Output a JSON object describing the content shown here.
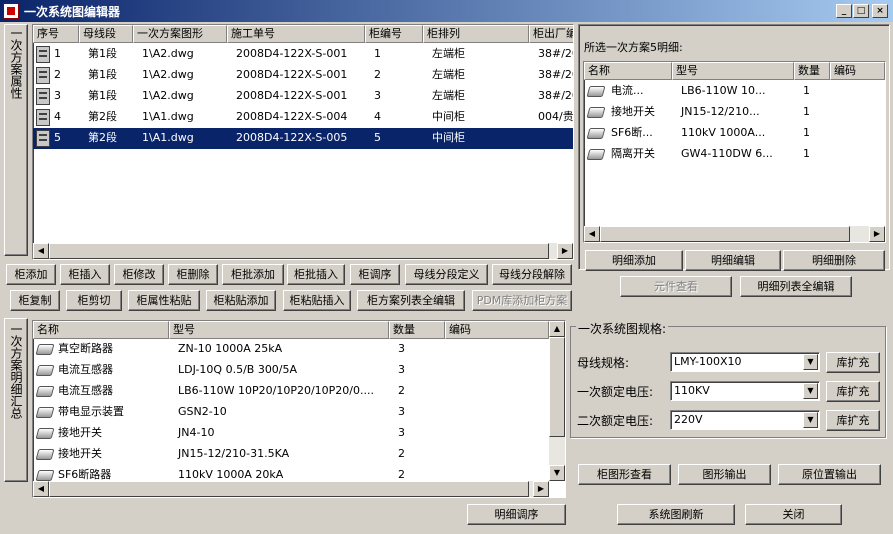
{
  "window": {
    "title": "一次系统图编辑器",
    "min": "_",
    "max": "□",
    "close": "×"
  },
  "left_tab": "一次方案属性",
  "bottom_tab": "一次方案明细汇总",
  "scheme_table": {
    "headers": [
      "序号",
      "母线段",
      "一次方案图形",
      "施工单号",
      "柜编号",
      "柜排列",
      "柜出厂编"
    ],
    "rows": [
      [
        "1",
        "第1段",
        "1\\A2.dwg",
        "2008D4-122X-S-001",
        "1",
        "左端柜",
        "38#/20"
      ],
      [
        "2",
        "第1段",
        "1\\A2.dwg",
        "2008D4-122X-S-001",
        "2",
        "左端柜",
        "38#/20"
      ],
      [
        "3",
        "第1段",
        "1\\A2.dwg",
        "2008D4-122X-S-001",
        "3",
        "左端柜",
        "38#/20"
      ],
      [
        "4",
        "第2段",
        "1\\A1.dwg",
        "2008D4-122X-S-004",
        "4",
        "中间柜",
        "004/贵"
      ],
      [
        "5",
        "第2段",
        "1\\A1.dwg",
        "2008D4-122X-S-005",
        "5",
        "中间柜",
        ""
      ]
    ]
  },
  "buttons_row1": [
    "柜添加",
    "柜插入",
    "柜修改",
    "柜删除",
    "柜批添加",
    "柜批插入",
    "柜调序",
    "母线分段定义",
    "母线分段解除"
  ],
  "buttons_row2": [
    "柜复制",
    "柜剪切",
    "柜属性粘贴",
    "柜粘贴添加",
    "柜粘贴插入",
    "柜方案列表全编辑",
    "PDM库添加柜方案"
  ],
  "detail_panel": {
    "caption": "所选一次方案5明细:",
    "headers": [
      "名称",
      "型号",
      "数量",
      "编码"
    ],
    "rows": [
      [
        "电流...",
        "LB6-110W 10...",
        "1",
        ""
      ],
      [
        "接地开关",
        "JN15-12/210...",
        "1",
        ""
      ],
      [
        "SF6断...",
        "110kV 1000A...",
        "1",
        ""
      ],
      [
        "隔离开关",
        "GW4-110DW 6...",
        "1",
        ""
      ]
    ],
    "buttons": [
      "明细添加",
      "明细编辑",
      "明细删除"
    ],
    "buttons2": [
      "元件查看",
      "明细列表全编辑"
    ]
  },
  "summary_table": {
    "headers": [
      "名称",
      "型号",
      "数量",
      "编码"
    ],
    "rows": [
      [
        "真空断路器",
        "ZN-10 1000A 25kA",
        "3",
        ""
      ],
      [
        "电流互感器",
        "LDJ-10Q 0.5/B 300/5A",
        "3",
        ""
      ],
      [
        "电流互感器",
        "LB6-110W 10P20/10P20/10P20/0....",
        "2",
        ""
      ],
      [
        "带电显示装置",
        "GSN2-10",
        "3",
        ""
      ],
      [
        "接地开关",
        "JN4-10",
        "3",
        ""
      ],
      [
        "接地开关",
        "JN15-12/210-31.5KA",
        "2",
        ""
      ],
      [
        "SF6断路器",
        "110kV 1000A 20kA",
        "2",
        ""
      ]
    ]
  },
  "spec": {
    "group_title": "一次系统图规格:",
    "fields": [
      {
        "label": "母线规格:",
        "value": "LMY-100X10",
        "button": "库扩充"
      },
      {
        "label": "一次额定电压:",
        "value": "110KV",
        "button": "库扩充"
      },
      {
        "label": "二次额定电压:",
        "value": "220V",
        "button": "库扩充"
      }
    ]
  },
  "bottom_buttons": {
    "reorder": "明细调序",
    "view": "柜图形查看",
    "output": "图形输出",
    "inplace": "原位置输出",
    "refresh": "系统图刷新",
    "close": "关闭"
  }
}
